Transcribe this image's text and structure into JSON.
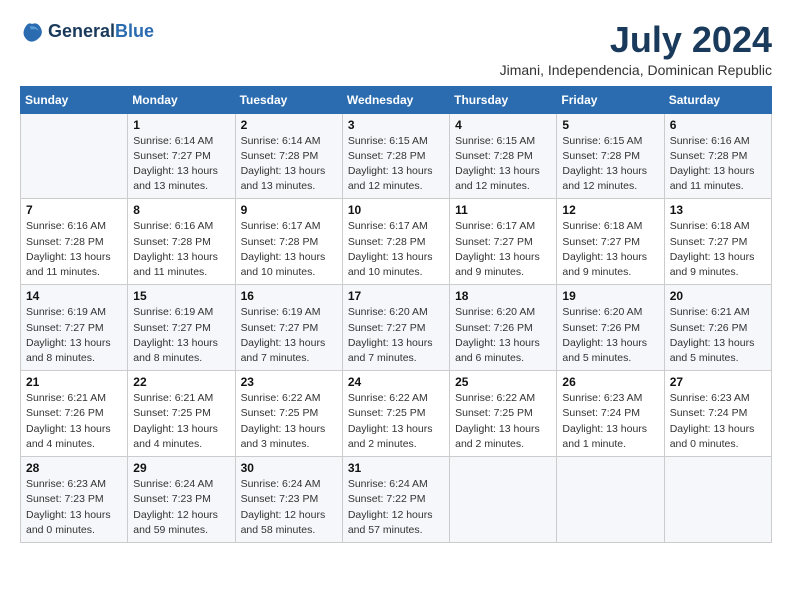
{
  "header": {
    "logo_line1": "General",
    "logo_line2": "Blue",
    "month_year": "July 2024",
    "location": "Jimani, Independencia, Dominican Republic"
  },
  "weekdays": [
    "Sunday",
    "Monday",
    "Tuesday",
    "Wednesday",
    "Thursday",
    "Friday",
    "Saturday"
  ],
  "weeks": [
    [
      {
        "day": "",
        "info": ""
      },
      {
        "day": "1",
        "info": "Sunrise: 6:14 AM\nSunset: 7:27 PM\nDaylight: 13 hours\nand 13 minutes."
      },
      {
        "day": "2",
        "info": "Sunrise: 6:14 AM\nSunset: 7:28 PM\nDaylight: 13 hours\nand 13 minutes."
      },
      {
        "day": "3",
        "info": "Sunrise: 6:15 AM\nSunset: 7:28 PM\nDaylight: 13 hours\nand 12 minutes."
      },
      {
        "day": "4",
        "info": "Sunrise: 6:15 AM\nSunset: 7:28 PM\nDaylight: 13 hours\nand 12 minutes."
      },
      {
        "day": "5",
        "info": "Sunrise: 6:15 AM\nSunset: 7:28 PM\nDaylight: 13 hours\nand 12 minutes."
      },
      {
        "day": "6",
        "info": "Sunrise: 6:16 AM\nSunset: 7:28 PM\nDaylight: 13 hours\nand 11 minutes."
      }
    ],
    [
      {
        "day": "7",
        "info": "Sunrise: 6:16 AM\nSunset: 7:28 PM\nDaylight: 13 hours\nand 11 minutes."
      },
      {
        "day": "8",
        "info": "Sunrise: 6:16 AM\nSunset: 7:28 PM\nDaylight: 13 hours\nand 11 minutes."
      },
      {
        "day": "9",
        "info": "Sunrise: 6:17 AM\nSunset: 7:28 PM\nDaylight: 13 hours\nand 10 minutes."
      },
      {
        "day": "10",
        "info": "Sunrise: 6:17 AM\nSunset: 7:28 PM\nDaylight: 13 hours\nand 10 minutes."
      },
      {
        "day": "11",
        "info": "Sunrise: 6:17 AM\nSunset: 7:27 PM\nDaylight: 13 hours\nand 9 minutes."
      },
      {
        "day": "12",
        "info": "Sunrise: 6:18 AM\nSunset: 7:27 PM\nDaylight: 13 hours\nand 9 minutes."
      },
      {
        "day": "13",
        "info": "Sunrise: 6:18 AM\nSunset: 7:27 PM\nDaylight: 13 hours\nand 9 minutes."
      }
    ],
    [
      {
        "day": "14",
        "info": "Sunrise: 6:19 AM\nSunset: 7:27 PM\nDaylight: 13 hours\nand 8 minutes."
      },
      {
        "day": "15",
        "info": "Sunrise: 6:19 AM\nSunset: 7:27 PM\nDaylight: 13 hours\nand 8 minutes."
      },
      {
        "day": "16",
        "info": "Sunrise: 6:19 AM\nSunset: 7:27 PM\nDaylight: 13 hours\nand 7 minutes."
      },
      {
        "day": "17",
        "info": "Sunrise: 6:20 AM\nSunset: 7:27 PM\nDaylight: 13 hours\nand 7 minutes."
      },
      {
        "day": "18",
        "info": "Sunrise: 6:20 AM\nSunset: 7:26 PM\nDaylight: 13 hours\nand 6 minutes."
      },
      {
        "day": "19",
        "info": "Sunrise: 6:20 AM\nSunset: 7:26 PM\nDaylight: 13 hours\nand 5 minutes."
      },
      {
        "day": "20",
        "info": "Sunrise: 6:21 AM\nSunset: 7:26 PM\nDaylight: 13 hours\nand 5 minutes."
      }
    ],
    [
      {
        "day": "21",
        "info": "Sunrise: 6:21 AM\nSunset: 7:26 PM\nDaylight: 13 hours\nand 4 minutes."
      },
      {
        "day": "22",
        "info": "Sunrise: 6:21 AM\nSunset: 7:25 PM\nDaylight: 13 hours\nand 4 minutes."
      },
      {
        "day": "23",
        "info": "Sunrise: 6:22 AM\nSunset: 7:25 PM\nDaylight: 13 hours\nand 3 minutes."
      },
      {
        "day": "24",
        "info": "Sunrise: 6:22 AM\nSunset: 7:25 PM\nDaylight: 13 hours\nand 2 minutes."
      },
      {
        "day": "25",
        "info": "Sunrise: 6:22 AM\nSunset: 7:25 PM\nDaylight: 13 hours\nand 2 minutes."
      },
      {
        "day": "26",
        "info": "Sunrise: 6:23 AM\nSunset: 7:24 PM\nDaylight: 13 hours\nand 1 minute."
      },
      {
        "day": "27",
        "info": "Sunrise: 6:23 AM\nSunset: 7:24 PM\nDaylight: 13 hours\nand 0 minutes."
      }
    ],
    [
      {
        "day": "28",
        "info": "Sunrise: 6:23 AM\nSunset: 7:23 PM\nDaylight: 13 hours\nand 0 minutes."
      },
      {
        "day": "29",
        "info": "Sunrise: 6:24 AM\nSunset: 7:23 PM\nDaylight: 12 hours\nand 59 minutes."
      },
      {
        "day": "30",
        "info": "Sunrise: 6:24 AM\nSunset: 7:23 PM\nDaylight: 12 hours\nand 58 minutes."
      },
      {
        "day": "31",
        "info": "Sunrise: 6:24 AM\nSunset: 7:22 PM\nDaylight: 12 hours\nand 57 minutes."
      },
      {
        "day": "",
        "info": ""
      },
      {
        "day": "",
        "info": ""
      },
      {
        "day": "",
        "info": ""
      }
    ]
  ]
}
